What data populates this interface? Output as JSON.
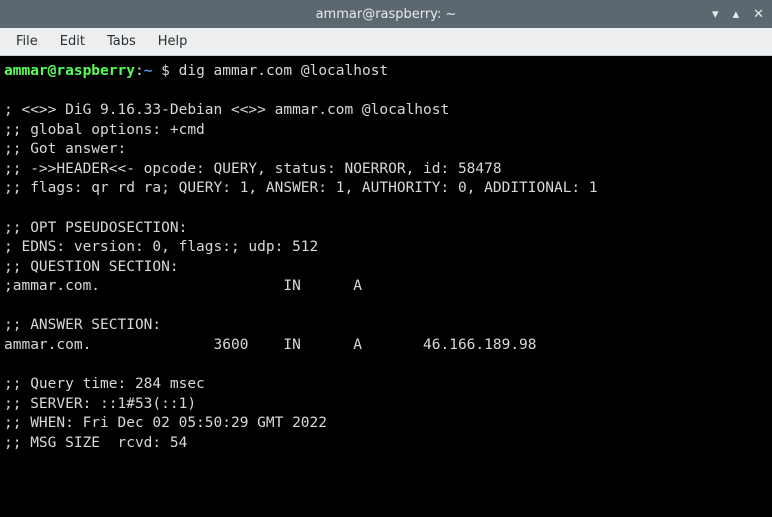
{
  "window": {
    "title": "ammar@raspberry: ~"
  },
  "menu": {
    "file": "File",
    "edit": "Edit",
    "tabs": "Tabs",
    "help": "Help"
  },
  "prompt": {
    "user": "ammar",
    "at": "@",
    "host": "raspberry",
    "colon": ":",
    "path": "~",
    "symbol": " $ "
  },
  "command": "dig ammar.com @localhost",
  "output": {
    "l1": "",
    "l2": "; <<>> DiG 9.16.33-Debian <<>> ammar.com @localhost",
    "l3": ";; global options: +cmd",
    "l4": ";; Got answer:",
    "l5": ";; ->>HEADER<<- opcode: QUERY, status: NOERROR, id: 58478",
    "l6": ";; flags: qr rd ra; QUERY: 1, ANSWER: 1, AUTHORITY: 0, ADDITIONAL: 1",
    "l7": "",
    "l8": ";; OPT PSEUDOSECTION:",
    "l9": "; EDNS: version: 0, flags:; udp: 512",
    "l10": ";; QUESTION SECTION:",
    "l11": ";ammar.com.                     IN      A",
    "l12": "",
    "l13": ";; ANSWER SECTION:",
    "l14": "ammar.com.              3600    IN      A       46.166.189.98",
    "l15": "",
    "l16": ";; Query time: 284 msec",
    "l17": ";; SERVER: ::1#53(::1)",
    "l18": ";; WHEN: Fri Dec 02 05:50:29 GMT 2022",
    "l19": ";; MSG SIZE  rcvd: 54"
  }
}
